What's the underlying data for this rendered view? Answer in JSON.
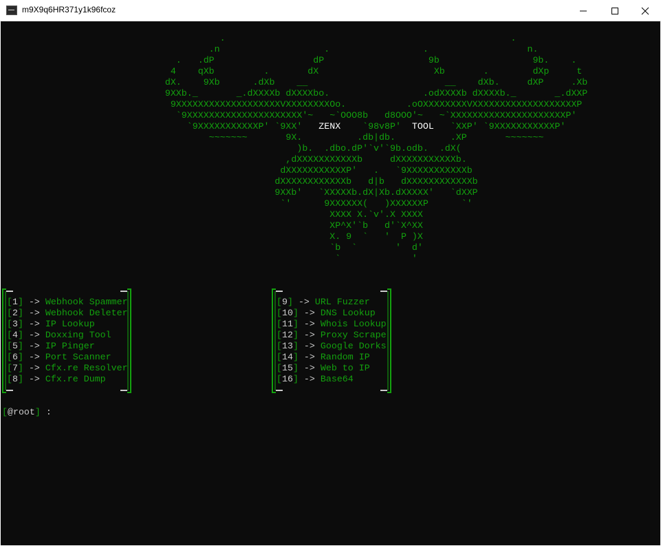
{
  "window": {
    "title": "m9X9q6HR371y1k96fcoz"
  },
  "banner": {
    "art_lines": [
      "                  .                                                    .",
      "                .n                   .                 .                  n.",
      "          .   .dP                  dP                   9b                 9b.    .",
      "         4    qXb         .       dX                     Xb       .        dXp     t",
      "        dX.    9Xb      .dXb    __                         __    dXb.     dXP     .Xb",
      "        9XXb._       _.dXXXXb dXXXXbo.                 .odXXXXb dXXXXb._       _.dXXP",
      "         9XXXXXXXXXXXXXXXXXXXVXXXXXXXXOo.           .oOXXXXXXXXVXXXXXXXXXXXXXXXXXXXP",
      "          `9XXXXXXXXXXXXXXXXXXXXX'~   ~`OOO8b   d8OOO'~   ~`XXXXXXXXXXXXXXXXXXXXXP'",
      "            `9XXXXXXXXXXXP' `9XX'   ",
      "                ~~~~~~~       9X.          .db|db.          .XP       ~~~~~~~",
      "                                )b.  .dbo.dP'`v'`9b.odb.  .dX(",
      "                              ,dXXXXXXXXXXXb     dXXXXXXXXXXXb.",
      "                             dXXXXXXXXXXXP'   .   `9XXXXXXXXXXXb",
      "                            dXXXXXXXXXXXXb   d|b   dXXXXXXXXXXXXb",
      "                            9XXb'   `XXXXXb.dX|Xb.dXXXXX'   `dXXP",
      "                             `'      9XXXXXX(   )XXXXXXP      `'",
      "                                      XXXX X.`v'.X XXXX",
      "                                      XP^X'`b   d'`X^XX",
      "                                      X. 9  `   '  P )X",
      "                                      `b  `       '  d'",
      "                                       `             '"
    ],
    "line9_mid_a": "ZENX",
    "line9_gap": "    `98v8P'  ",
    "line9_mid_b": "TOOL",
    "line9_tail": "   `XXP' `9XXXXXXXXXXXP'"
  },
  "menu_left": [
    {
      "num": "1",
      "label": "Webhook Spammer"
    },
    {
      "num": "2",
      "label": "Webhook Deleter"
    },
    {
      "num": "3",
      "label": "IP Lookup"
    },
    {
      "num": "4",
      "label": "Doxxing Tool"
    },
    {
      "num": "5",
      "label": "IP Pinger"
    },
    {
      "num": "6",
      "label": "Port Scanner"
    },
    {
      "num": "7",
      "label": "Cfx.re Resolver"
    },
    {
      "num": "8",
      "label": "Cfx.re Dump"
    }
  ],
  "menu_right": [
    {
      "num": "9",
      "label": "URL Fuzzer"
    },
    {
      "num": "10",
      "label": "DNS Lookup"
    },
    {
      "num": "11",
      "label": "Whois Lookup"
    },
    {
      "num": "12",
      "label": "Proxy Scrape"
    },
    {
      "num": "13",
      "label": "Google Dorks"
    },
    {
      "num": "14",
      "label": "Random IP"
    },
    {
      "num": "15",
      "label": "Web to IP"
    },
    {
      "num": "16",
      "label": "Base64"
    }
  ],
  "menu_arrow": "->",
  "prompt": {
    "user": "@root",
    "suffix": " :"
  }
}
